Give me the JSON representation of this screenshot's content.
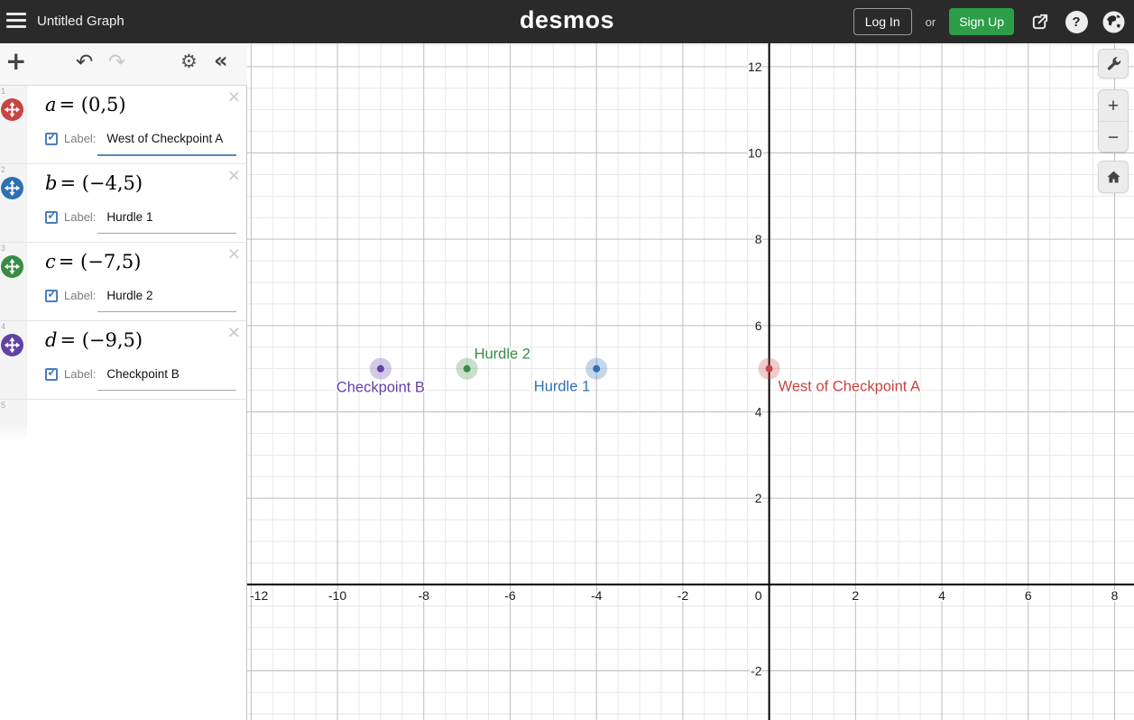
{
  "topbar": {
    "title": "Untitled Graph",
    "logo": "desmos",
    "login_label": "Log In",
    "or_label": "or",
    "signup_label": "Sign Up"
  },
  "icons": {
    "add": "+",
    "undo": "↶",
    "redo": "↷",
    "settings": "⚙",
    "collapse": "«",
    "close": "×",
    "check": "✓",
    "question": "?",
    "zoom_in": "+",
    "zoom_out": "−"
  },
  "expressions": [
    {
      "row_number": "1",
      "point_color": "#c74440",
      "var": "a",
      "rhs": "= (0,5)",
      "label_caption": "Label:",
      "label_value": "West of Checkpoint A",
      "checked": true
    },
    {
      "row_number": "2",
      "point_color": "#2d70b3",
      "var": "b",
      "rhs": "= (−4,5)",
      "label_caption": "Label:",
      "label_value": "Hurdle 1",
      "checked": true
    },
    {
      "row_number": "3",
      "point_color": "#388c46",
      "var": "c",
      "rhs": "= (−7,5)",
      "label_caption": "Label:",
      "label_value": "Hurdle 2",
      "checked": true
    },
    {
      "row_number": "4",
      "point_color": "#6042a6",
      "var": "d",
      "rhs": "= (−9,5)",
      "label_caption": "Label:",
      "label_value": "Checkpoint B",
      "checked": true
    }
  ],
  "empty_row_number": "5",
  "chart_data": {
    "type": "scatter",
    "title": "",
    "xlabel": "",
    "ylabel": "",
    "grid": true,
    "major_step": 2,
    "minor_step": 0.5,
    "xlim": [
      -12.09,
      8.45
    ],
    "ylim": [
      -3.14,
      12.54
    ],
    "x_ticks": [
      -12,
      -10,
      -8,
      -6,
      -4,
      -2,
      2,
      4,
      6,
      8
    ],
    "y_ticks": [
      -2,
      2,
      4,
      6,
      8,
      10,
      12
    ],
    "origin_label": "0",
    "colors": {
      "axis": "#000000",
      "major_grid": "#bdbdbd",
      "minor_grid": "#e7e7e7"
    },
    "points": [
      {
        "x": 0,
        "y": 5,
        "color": "#c74440",
        "label": "West of Checkpoint A",
        "label_anchor": "start",
        "label_dx": 10,
        "label_dy": 25
      },
      {
        "x": -4,
        "y": 5,
        "color": "#2d70b3",
        "label": "Hurdle 1",
        "label_anchor": "end",
        "label_dx": -7,
        "label_dy": 25
      },
      {
        "x": -7,
        "y": 5,
        "color": "#388c46",
        "label": "Hurdle 2",
        "label_anchor": "start",
        "label_dx": 8,
        "label_dy": -11
      },
      {
        "x": -9,
        "y": 5,
        "color": "#6042a6",
        "label": "Checkpoint B",
        "label_anchor": "middle",
        "label_dx": 0,
        "label_dy": 26
      }
    ]
  }
}
